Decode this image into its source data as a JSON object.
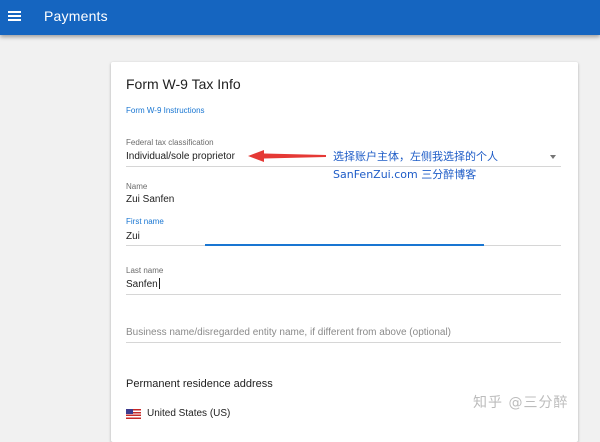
{
  "appbar": {
    "title": "Payments"
  },
  "form": {
    "title": "Form W-9 Tax Info",
    "instructions_link": "Form W-9 Instructions",
    "tax_classification": {
      "label": "Federal tax classification",
      "value": "Individual/sole proprietor"
    },
    "name": {
      "label": "Name",
      "value": "Zui Sanfen"
    },
    "first_name": {
      "label": "First name",
      "value": "Zui"
    },
    "last_name": {
      "label": "Last name",
      "value": "Sanfen"
    },
    "business_name": {
      "placeholder": "Business name/disregarded entity name, if different from above (optional)"
    },
    "address_section": {
      "heading": "Permanent residence address"
    },
    "country": {
      "value": "United States (US)"
    }
  },
  "annotation": {
    "line1": "选择账户主体，左侧我选择的个人",
    "line2": "SanFenZui.com 三分醉博客",
    "color": "#1e5cc7",
    "arrow_color": "#e53935"
  },
  "watermark": "知乎 @三分醉"
}
